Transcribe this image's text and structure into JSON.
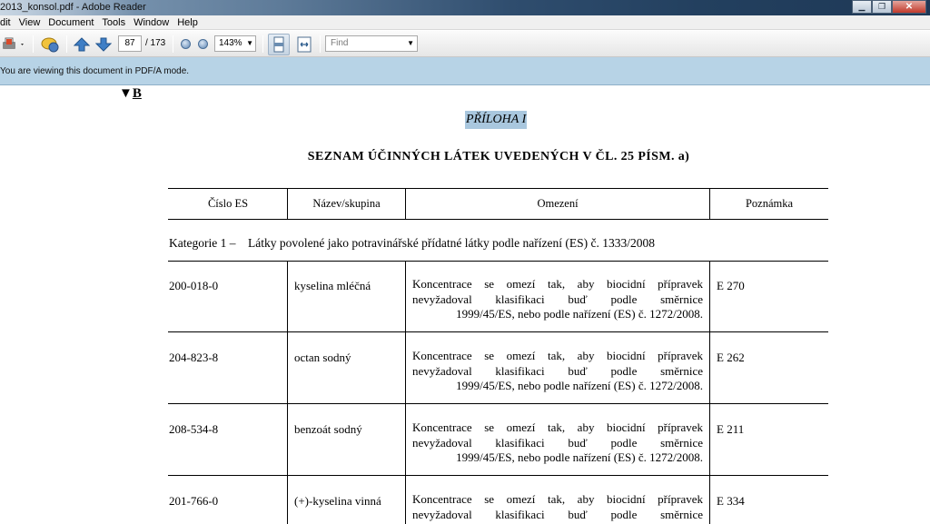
{
  "window": {
    "title": "2013_konsol.pdf - Adobe Reader",
    "buttons": {
      "minimize": "▁",
      "maximize": "❐",
      "close": "✕"
    }
  },
  "menubar": {
    "items": [
      "dit",
      "View",
      "Document",
      "Tools",
      "Window",
      "Help"
    ]
  },
  "toolbar": {
    "icons": [
      "print-icon",
      "comment-icon",
      "previous-page-icon",
      "next-page-icon",
      "zoom-out-icon",
      "zoom-in-icon",
      "fit-page-icon",
      "fit-width-icon"
    ],
    "current_page": "87",
    "page_total": "/ 173",
    "zoom": "143%",
    "find_placeholder": "Find"
  },
  "infobar": {
    "message": "You are viewing this document in PDF/A mode."
  },
  "document": {
    "marker_symbol": "▼",
    "marker_letter": "B",
    "annex_title": "PŘÍLOHA I",
    "heading": "SEZNAM ÚČINNÝCH LÁTEK UVEDENÝCH V ČL. 25 PÍSM. a)",
    "table": {
      "columns": [
        "Číslo ES",
        "Název/skupina",
        "Omezení",
        "Poznámka"
      ],
      "category": "Kategorie 1 –    Látky povolené jako potravinářské přídatné látky podle nařízení (ES) č. 1333/2008",
      "rows": [
        {
          "es": "200-018-0",
          "name": "kyselina mléčná",
          "omez_line1": "Koncentrace se omezí tak, aby biocidní přípravek",
          "omez_line2": "nevyžadoval klasifikaci buď podle směrnice",
          "omez_line3": "1999/45/ES, nebo podle nařízení (ES) č. 1272/2008.",
          "note": "E 270"
        },
        {
          "es": "204-823-8",
          "name": "octan sodný",
          "omez_line1": "Koncentrace se omezí tak, aby biocidní přípravek",
          "omez_line2": "nevyžadoval klasifikaci buď podle směrnice",
          "omez_line3": "1999/45/ES, nebo podle nařízení (ES) č. 1272/2008.",
          "note": "E 262"
        },
        {
          "es": "208-534-8",
          "name": "benzoát sodný",
          "omez_line1": "Koncentrace se omezí tak, aby biocidní přípravek",
          "omez_line2": "nevyžadoval klasifikaci buď podle směrnice",
          "omez_line3": "1999/45/ES, nebo podle nařízení (ES) č. 1272/2008.",
          "note": "E 211"
        },
        {
          "es": "201-766-0",
          "name": "(+)-kyselina vinná",
          "omez_line1": "Koncentrace se omezí tak, aby biocidní přípravek",
          "omez_line2": "nevyžadoval klasifikaci buď podle směrnice",
          "note": "E 334"
        }
      ]
    }
  },
  "colors": {
    "selection_highlight": "#a9c7de",
    "infobar_bg": "#b7d3e6"
  }
}
